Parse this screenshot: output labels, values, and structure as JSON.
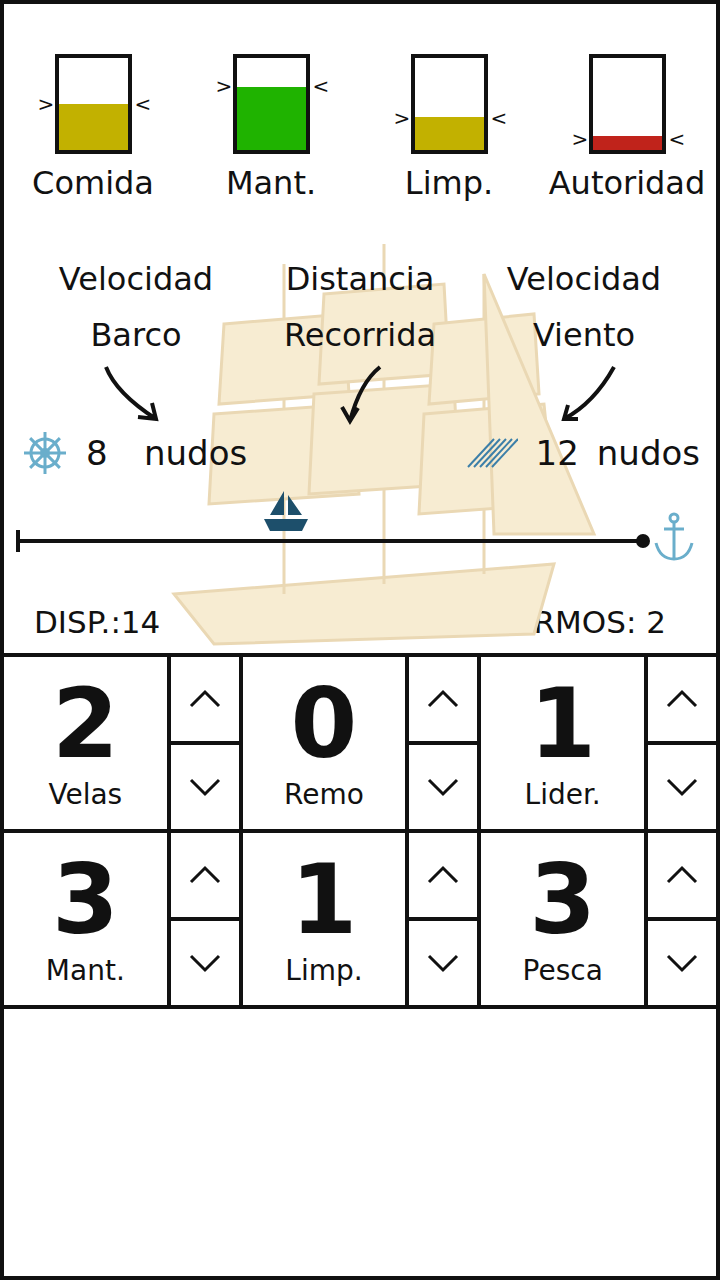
{
  "meters": [
    {
      "label": "Comida",
      "level": 0.5,
      "color": "#c2b100"
    },
    {
      "label": "Mant.",
      "level": 0.68,
      "color": "#1fb300"
    },
    {
      "label": "Limp.",
      "level": 0.36,
      "color": "#c2b100"
    },
    {
      "label": "Autoridad",
      "level": 0.15,
      "color": "#c0231b"
    }
  ],
  "markers": {
    "left": ">",
    "right": "<"
  },
  "ship_speed": {
    "label": [
      "Velocidad",
      "Barco"
    ],
    "value": "8",
    "unit": "nudos"
  },
  "distance": {
    "label": [
      "Distancia",
      "Recorrida"
    ],
    "level": 0.43
  },
  "wind_speed": {
    "label": [
      "Velocidad",
      "Viento"
    ],
    "value": "12",
    "unit": "nudos"
  },
  "crew": {
    "available_label": "DISP.:",
    "available": "14",
    "sick_label": "ENFERMOS:",
    "sick": "2"
  },
  "jobs": [
    {
      "name": "Velas",
      "count": "2"
    },
    {
      "name": "Remo",
      "count": "0"
    },
    {
      "name": "Lider.",
      "count": "1"
    },
    {
      "name": "Mant.",
      "count": "3"
    },
    {
      "name": "Limp.",
      "count": "1"
    },
    {
      "name": "Pesca",
      "count": "3"
    }
  ]
}
